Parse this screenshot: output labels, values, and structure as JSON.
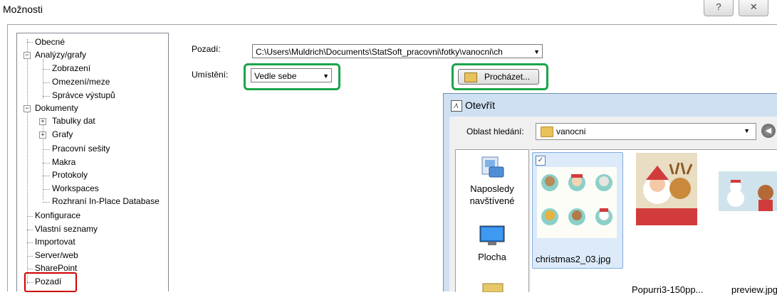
{
  "window": {
    "title": "Možnosti",
    "help_icon": "?",
    "close_icon": "✕"
  },
  "tree": {
    "items": [
      {
        "label": "Obecné"
      },
      {
        "label": "Analýzy/grafy",
        "expander": "−"
      },
      {
        "label": "Zobrazení"
      },
      {
        "label": "Omezení/meze"
      },
      {
        "label": "Správce výstupů"
      },
      {
        "label": "Dokumenty",
        "expander": "−"
      },
      {
        "label": "Tabulky dat",
        "expander": "+"
      },
      {
        "label": "Grafy",
        "expander": "+"
      },
      {
        "label": "Pracovní sešity"
      },
      {
        "label": "Makra"
      },
      {
        "label": "Protokoly"
      },
      {
        "label": "Workspaces"
      },
      {
        "label": "Rozhraní In-Place Database"
      },
      {
        "label": "Konfigurace"
      },
      {
        "label": "Vlastní seznamy"
      },
      {
        "label": "Importovat"
      },
      {
        "label": "Server/web"
      },
      {
        "label": "SharePoint"
      },
      {
        "label": "Pozadí",
        "selected": true
      }
    ]
  },
  "form": {
    "background_label": "Pozadí:",
    "background_path": "C:\\Users\\Muldrich\\Documents\\StatSoft_pracovni\\fotky\\vanocni\\ch",
    "placement_label": "Umístění:",
    "placement_value": "Vedle sebe",
    "browse_label": "Procházet...",
    "highlight_color": "#1aa54a",
    "selected_highlight_color": "#d00000"
  },
  "open_dialog": {
    "title": "Otevřít",
    "look_in_label": "Oblast hledání:",
    "look_in_value": "vanocni",
    "places": [
      {
        "label": "Naposledy navštívené",
        "icon": "recent-places-icon"
      },
      {
        "label": "Plocha",
        "icon": "desktop-icon"
      },
      {
        "label": "",
        "icon": "folder-icon"
      }
    ],
    "files": [
      {
        "name": "christmas2_03.jpg",
        "selected": true,
        "checkbox": "✓"
      },
      {
        "name": "Popurri3-150pp..."
      },
      {
        "name": "preview.jpg"
      }
    ]
  }
}
